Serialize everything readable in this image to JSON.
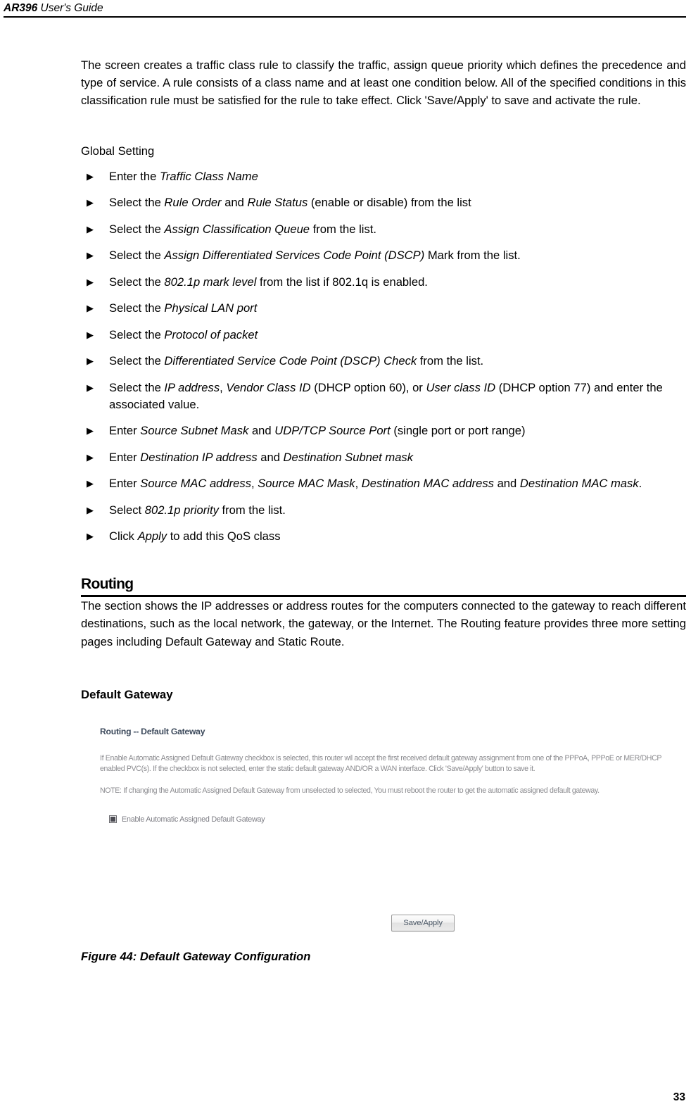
{
  "header": {
    "model": "AR396",
    "guide": " User's Guide"
  },
  "intro_paragraph": "The screen creates a traffic class rule to classify the traffic, assign queue priority which defines the precedence and type of service. A rule consists of a class name and at least one condition below. All of the specified conditions in this classification rule must be satisfied for the rule to take effect. Click 'Save/Apply' to save and activate the rule.",
  "global_setting_label": "Global Setting",
  "bullet_marker": "▶",
  "bullets": [
    {
      "html": "Enter the <i>Traffic Class Name</i>"
    },
    {
      "html": "Select the <i>Rule Order</i> and <i>Rule Status</i> (enable or disable) from the list"
    },
    {
      "html": "Select the <i>Assign Classification Queue</i> from the list."
    },
    {
      "html": "Select the <i>Assign Differentiated Services Code Point (DSCP)</i> Mark from the list."
    },
    {
      "html": "Select the <i>802.1p mark level</i> from the list if 802.1q is enabled."
    },
    {
      "html": "Select the <i>Physical LAN port</i>"
    },
    {
      "html": "Select the <i>Protocol of packet</i>"
    },
    {
      "html": "Select the <i>Differentiated Service Code Point (DSCP) Check</i> from the list."
    },
    {
      "html": "Select the <i>IP address</i>, <i>Vendor Class ID</i> (DHCP option 60), or <i>User class ID</i> (DHCP option 77) and enter the associated value."
    },
    {
      "html": "Enter <i>Source Subnet Mask</i> and <i>UDP/TCP Source Port</i> (single port or port range)"
    },
    {
      "html": "Enter <i>Destination IP address</i> and <i>Destination Subnet mask</i>"
    },
    {
      "html": "Enter <i>Source MAC address</i>, <i>Source MAC Mask</i>, <i>Destination MAC address</i> and <i>Destination MAC mask</i>."
    },
    {
      "html": "Select <i>802.1p priority</i> from the list."
    },
    {
      "html": "Click <i>Apply</i> to add this QoS class"
    }
  ],
  "routing_section": {
    "heading": "Routing",
    "paragraph": "The section shows the IP addresses or address routes for the computers connected to the gateway to reach different destinations, such as the local network, the gateway, or the Internet. The Routing feature provides three more setting pages including Default Gateway and Static Route.",
    "sub_heading": "Default Gateway"
  },
  "router_ui": {
    "title": "Routing -- Default Gateway",
    "description": "If Enable Automatic Assigned Default Gateway checkbox is selected, this router wil accept the first received default gateway assignment from one of the PPPoA, PPPoE or MER/DHCP enabled PVC(s). If the checkbox is not selected, enter the static default gateway AND/OR a WAN interface. Click 'Save/Apply' button to save it.",
    "note": "NOTE: If changing the Automatic Assigned Default Gateway from unselected to selected, You must reboot the router to get the automatic assigned default gateway.",
    "checkbox_label": "Enable Automatic Assigned Default Gateway",
    "checkbox_checked": true,
    "save_apply_label": "Save/Apply",
    "title_color": "#3d4a5c",
    "text_color": "#8b8b8f"
  },
  "figure_caption": "Figure 44: Default Gateway Configuration",
  "page_number": "33"
}
